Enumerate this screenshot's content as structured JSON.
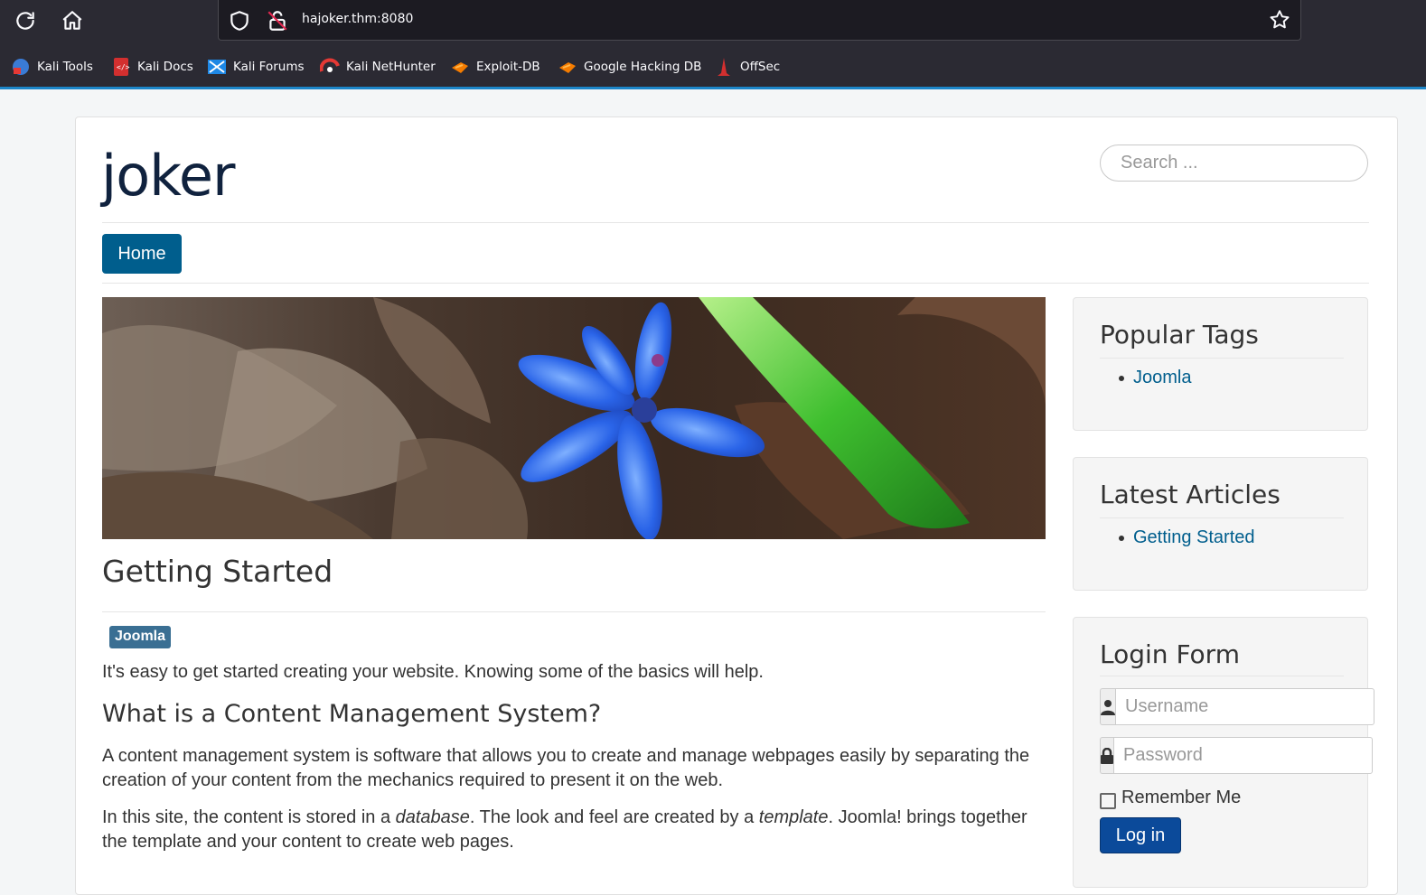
{
  "browser": {
    "url": "hajoker.thm:8080",
    "bookmarks": [
      {
        "label": "Kali Tools",
        "icon": "kali-tools-icon"
      },
      {
        "label": "Kali Docs",
        "icon": "kali-docs-icon"
      },
      {
        "label": "Kali Forums",
        "icon": "kali-forums-icon"
      },
      {
        "label": "Kali NetHunter",
        "icon": "kali-nethunter-icon"
      },
      {
        "label": "Exploit-DB",
        "icon": "exploit-db-icon"
      },
      {
        "label": "Google Hacking DB",
        "icon": "ghdb-icon"
      },
      {
        "label": "OffSec",
        "icon": "offsec-icon"
      }
    ]
  },
  "site": {
    "brand": "joker",
    "search_placeholder": "Search ...",
    "nav": {
      "home": "Home"
    }
  },
  "article": {
    "title": "Getting Started",
    "tag": "Joomla",
    "intro": "It's easy to get started creating your website. Knowing some of the basics will help.",
    "heading": "What is a Content Management System?",
    "para1": "A content management system is software that allows you to create and manage webpages easily by separating the creation of your content from the mechanics required to present it on the web.",
    "para2": {
      "a": "In this site, the content is stored in a ",
      "b": "database",
      "c": ". The look and feel are created by a ",
      "d": "template",
      "e": ". Joomla! brings together the template and your content to create web pages."
    }
  },
  "sidebar": {
    "popular_tags": {
      "title": "Popular Tags",
      "items": [
        "Joomla"
      ]
    },
    "latest_articles": {
      "title": "Latest Articles",
      "items": [
        "Getting Started"
      ]
    },
    "login": {
      "title": "Login Form",
      "username_placeholder": "Username",
      "password_placeholder": "Password",
      "remember": "Remember Me",
      "button": "Log in"
    }
  },
  "colors": {
    "chrome_bg": "#2b2a33",
    "accent": "#005e8d",
    "login_button": "#0b4a9a",
    "tag_bg": "#3a6f93"
  }
}
